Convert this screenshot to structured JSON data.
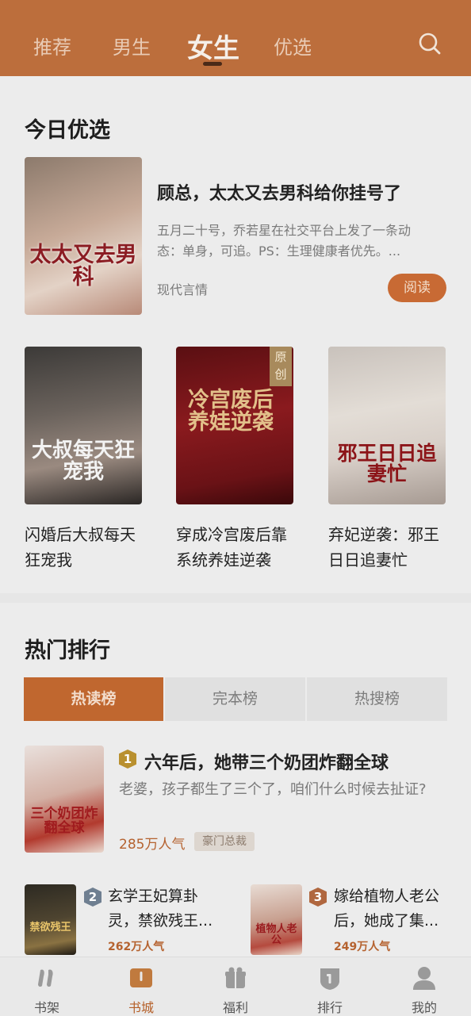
{
  "header": {
    "tabs": [
      "推荐",
      "男生",
      "女生",
      "优选"
    ],
    "active_tab": "女生"
  },
  "today": {
    "section_title": "今日优选",
    "featured": {
      "title": "顾总，太太又去男科给你挂号了",
      "description": "五月二十号，乔若星在社交平台上发了一条动态：单身，可追。PS：生理健康者优先。...",
      "genre": "现代言情",
      "read_label": "阅读",
      "cover_text": "太太又去男科"
    },
    "books": [
      {
        "title": "闪婚后大叔每天狂宠我",
        "cover_text": "大叔每天狂宠我"
      },
      {
        "title": "穿成冷宫废后靠系统养娃逆袭",
        "cover_text": "冷宫废后养娃逆袭",
        "badge": "原创"
      },
      {
        "title": "弃妃逆袭：邪王日日追妻忙",
        "cover_text": "邪王日日追妻忙"
      }
    ]
  },
  "ranking": {
    "section_title": "热门排行",
    "tabs": [
      "热读榜",
      "完本榜",
      "热搜榜"
    ],
    "active_tab": "热读榜",
    "first": {
      "rank": "1",
      "title": "六年后，她带三个奶团炸翻全球",
      "description": "老婆，孩子都生了三个了，咱们什么时候去扯证?",
      "popularity": "285万人气",
      "tag": "豪门总裁",
      "cover_text": "三个奶团炸翻全球"
    },
    "second": {
      "rank": "2",
      "title": "玄学王妃算卦灵，禁欲残王...",
      "popularity": "262万人气",
      "cover_text": "禁欲残王"
    },
    "third": {
      "rank": "3",
      "title": "嫁给植物人老公后，她成了集...",
      "popularity": "249万人气",
      "cover_text": "植物人老公"
    }
  },
  "bottom_nav": [
    {
      "label": "书架",
      "icon": "bookshelf-icon"
    },
    {
      "label": "书城",
      "icon": "bookstore-icon"
    },
    {
      "label": "福利",
      "icon": "gift-icon"
    },
    {
      "label": "排行",
      "icon": "ranking-icon"
    },
    {
      "label": "我的",
      "icon": "profile-icon"
    }
  ],
  "active_nav": "书城",
  "colors": {
    "accent": "#c0672f",
    "header": "#bc6e3c"
  }
}
